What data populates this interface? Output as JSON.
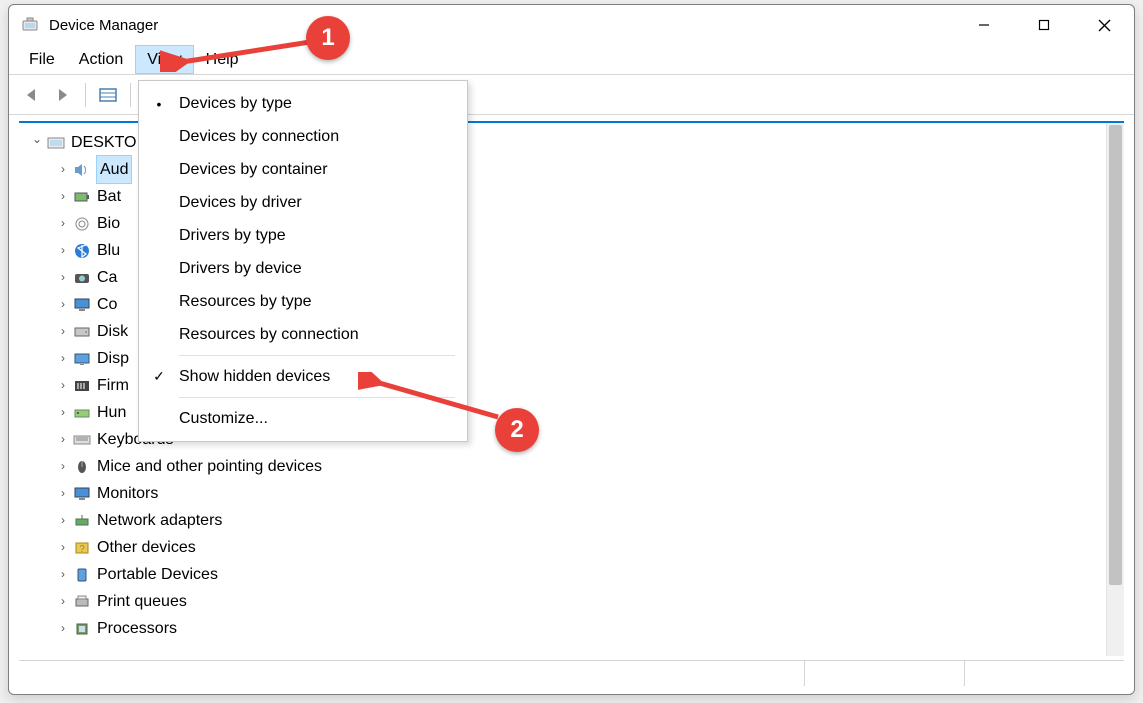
{
  "window": {
    "title": "Device Manager"
  },
  "menubar": {
    "items": [
      {
        "label": "File"
      },
      {
        "label": "Action"
      },
      {
        "label": "View",
        "active": true
      },
      {
        "label": "Help"
      }
    ]
  },
  "view_menu": {
    "items": [
      {
        "label": "Devices by type",
        "mark": "dot"
      },
      {
        "label": "Devices by connection"
      },
      {
        "label": "Devices by container"
      },
      {
        "label": "Devices by driver"
      },
      {
        "label": "Drivers by type"
      },
      {
        "label": "Drivers by device"
      },
      {
        "label": "Resources by type"
      },
      {
        "label": "Resources by connection"
      },
      {
        "separator": true
      },
      {
        "label": "Show hidden devices",
        "mark": "check"
      },
      {
        "separator": true
      },
      {
        "label": "Customize..."
      }
    ]
  },
  "tree": {
    "root": "DESKTO",
    "children": [
      {
        "label": "Aud",
        "icon": "speaker",
        "selected": true
      },
      {
        "label": "Bat",
        "icon": "battery"
      },
      {
        "label": "Bio",
        "icon": "fingerprint"
      },
      {
        "label": "Blu",
        "icon": "bluetooth"
      },
      {
        "label": "Ca",
        "icon": "camera"
      },
      {
        "label": "Co",
        "icon": "monitor"
      },
      {
        "label": "Disk",
        "icon": "disk"
      },
      {
        "label": "Disp",
        "icon": "display"
      },
      {
        "label": "Firm",
        "icon": "firmware"
      },
      {
        "label": "Hun",
        "icon": "hid"
      },
      {
        "label": "Keyboards",
        "icon": "keyboard"
      },
      {
        "label": "Mice and other pointing devices",
        "icon": "mouse"
      },
      {
        "label": "Monitors",
        "icon": "monitor"
      },
      {
        "label": "Network adapters",
        "icon": "network"
      },
      {
        "label": "Other devices",
        "icon": "other"
      },
      {
        "label": "Portable Devices",
        "icon": "portable"
      },
      {
        "label": "Print queues",
        "icon": "printer"
      },
      {
        "label": "Processors",
        "icon": "cpu"
      }
    ]
  },
  "annotations": {
    "callout1": "1",
    "callout2": "2"
  },
  "colors": {
    "accent": "#0078d7",
    "highlight": "#cce8ff",
    "annotation": "#e9413a"
  }
}
